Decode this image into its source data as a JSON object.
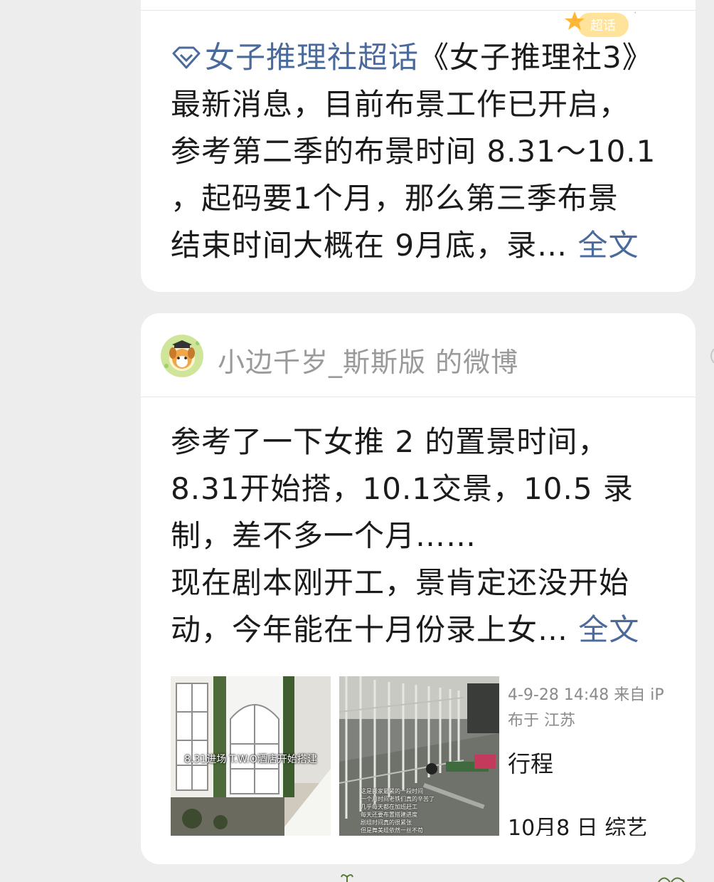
{
  "card1": {
    "topic_link": "女子推理社超话",
    "lines": [
      "《女子推理社3》",
      "最新消息，目前布景工作已开启，",
      "参考第二季的布景时间  8.31～10.1",
      "，起码要1个月，那么第三季布景",
      "结束时间大概在 9月底，录…"
    ],
    "full_text_link": "全文",
    "badge_text": "超话",
    "colors": {
      "link": "#4a6a9c"
    }
  },
  "card2": {
    "author": "小边千岁_斯斯版 的微博",
    "lines": [
      "参考了一下女推 2 的置景时间，",
      "8.31开始搭，10.1交景，10.5 录",
      "制，差不多一个月……",
      "现在剧本刚开工，景肯定还没开始",
      "动，今年能在十月份录上女…"
    ],
    "full_text_link": "全文",
    "thumb1_caption": "8.31进场 T.W.O酒店开始搭建",
    "thumb2_lines": [
      "这是搬家最紧的一段时间",
      "一个月时间老铁们真的辛苦了",
      "几乎每天都在加班赶工",
      "每天还要布置搭建进度",
      "剧组时间真的很紧张",
      "但是舞美组依然一丝不苟"
    ],
    "side_date": "4-9-28 14:48  来自 iP",
    "side_location": "布于 江苏",
    "side_title": "行程",
    "side_bottom": "10月8 日    综艺"
  }
}
